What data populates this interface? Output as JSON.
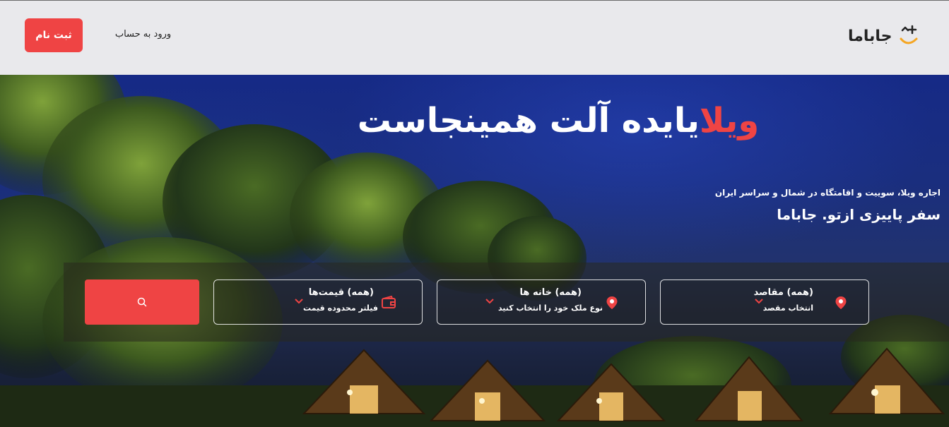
{
  "header": {
    "logo_text": "جاباما",
    "login_label": "ورود به حساب",
    "signup_label": "ثبت نام"
  },
  "hero": {
    "title_accent": "ویلا",
    "title_rest": "یایده آلت همینجاست",
    "subtitle": "اجاره ویلا، سوییت و اقامتگاه در شمال و سراسر ایران",
    "slogan": "سفر پاییزی ازتو. جاباما"
  },
  "search": {
    "destination": {
      "title": "(همه) مقاصد",
      "subtitle": "انتخاب مقصد",
      "icon": "location-pin-icon"
    },
    "house_type": {
      "title": "(همه) خانه ها",
      "subtitle": "نوع ملک خود را انتخاب کنید",
      "icon": "location-pin-icon"
    },
    "price": {
      "title": "(همه) قیمت‌ها",
      "subtitle": "فیلتر محدوده قیمت",
      "icon": "wallet-icon"
    },
    "button_icon": "search-icon"
  },
  "colors": {
    "brand": "#ef4444",
    "header_bg": "#e9e9ec",
    "logo_smile": "#f5a623"
  }
}
